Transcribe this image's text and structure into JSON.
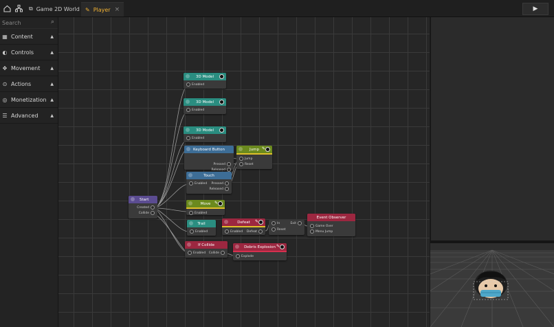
{
  "topbar": {
    "tabs": [
      {
        "label": "Game 2D World",
        "close": "×"
      },
      {
        "label": "Player",
        "close": "×"
      }
    ],
    "play_icon": "play-icon",
    "home_icon": "home-icon",
    "hierarchy_icon": "hierarchy-icon"
  },
  "sidebar": {
    "search": {
      "placeholder": "Search"
    },
    "categories": [
      {
        "label": "Content",
        "icon": "grid-icon"
      },
      {
        "label": "Controls",
        "icon": "controls-icon"
      },
      {
        "label": "Movement",
        "icon": "move-icon"
      },
      {
        "label": "Actions",
        "icon": "play-circle-icon"
      },
      {
        "label": "Monetization",
        "icon": "coins-icon"
      },
      {
        "label": "Advanced",
        "icon": "sliders-icon"
      }
    ]
  },
  "nodes": {
    "model1": {
      "title": "3D Model",
      "in": "Enabled"
    },
    "model2": {
      "title": "3D Model",
      "in": "Enabled"
    },
    "model3": {
      "title": "3D Model",
      "in": "Enabled"
    },
    "keyboard": {
      "title": "Keyboard Button",
      "out1": "Pressed",
      "out2": "Released"
    },
    "jump": {
      "title": "Jump",
      "in1": "Jump",
      "in2": "Reset"
    },
    "touch": {
      "title": "Touch",
      "in": "Enabled",
      "out1": "Pressed",
      "out2": "Released"
    },
    "start": {
      "title": "Start",
      "out1": "Created",
      "out2": "Collide"
    },
    "move": {
      "title": "Move",
      "in": "Enabled"
    },
    "trail": {
      "title": "Trail",
      "in": "Enabled"
    },
    "defeat": {
      "title": "Defeat",
      "in": "Enabled",
      "out": "Defeat"
    },
    "gate": {
      "in1": "In",
      "in2": "Reset",
      "out": "Exit"
    },
    "event_observer": {
      "title": "Event Observer",
      "in1": "Game Over",
      "in2": "Menu Jump"
    },
    "if_collide": {
      "title": "If Collide",
      "in": "Enabled",
      "out": "Collide"
    },
    "debris": {
      "title": "Debris Explosion",
      "in": "Explode"
    }
  },
  "colors": {
    "teal": "#2a8d80",
    "blue": "#3d6d96",
    "purple": "#5b4c91",
    "olive": "#6b8a1e",
    "red": "#9c2740",
    "accent_tab": "#f2b233"
  }
}
